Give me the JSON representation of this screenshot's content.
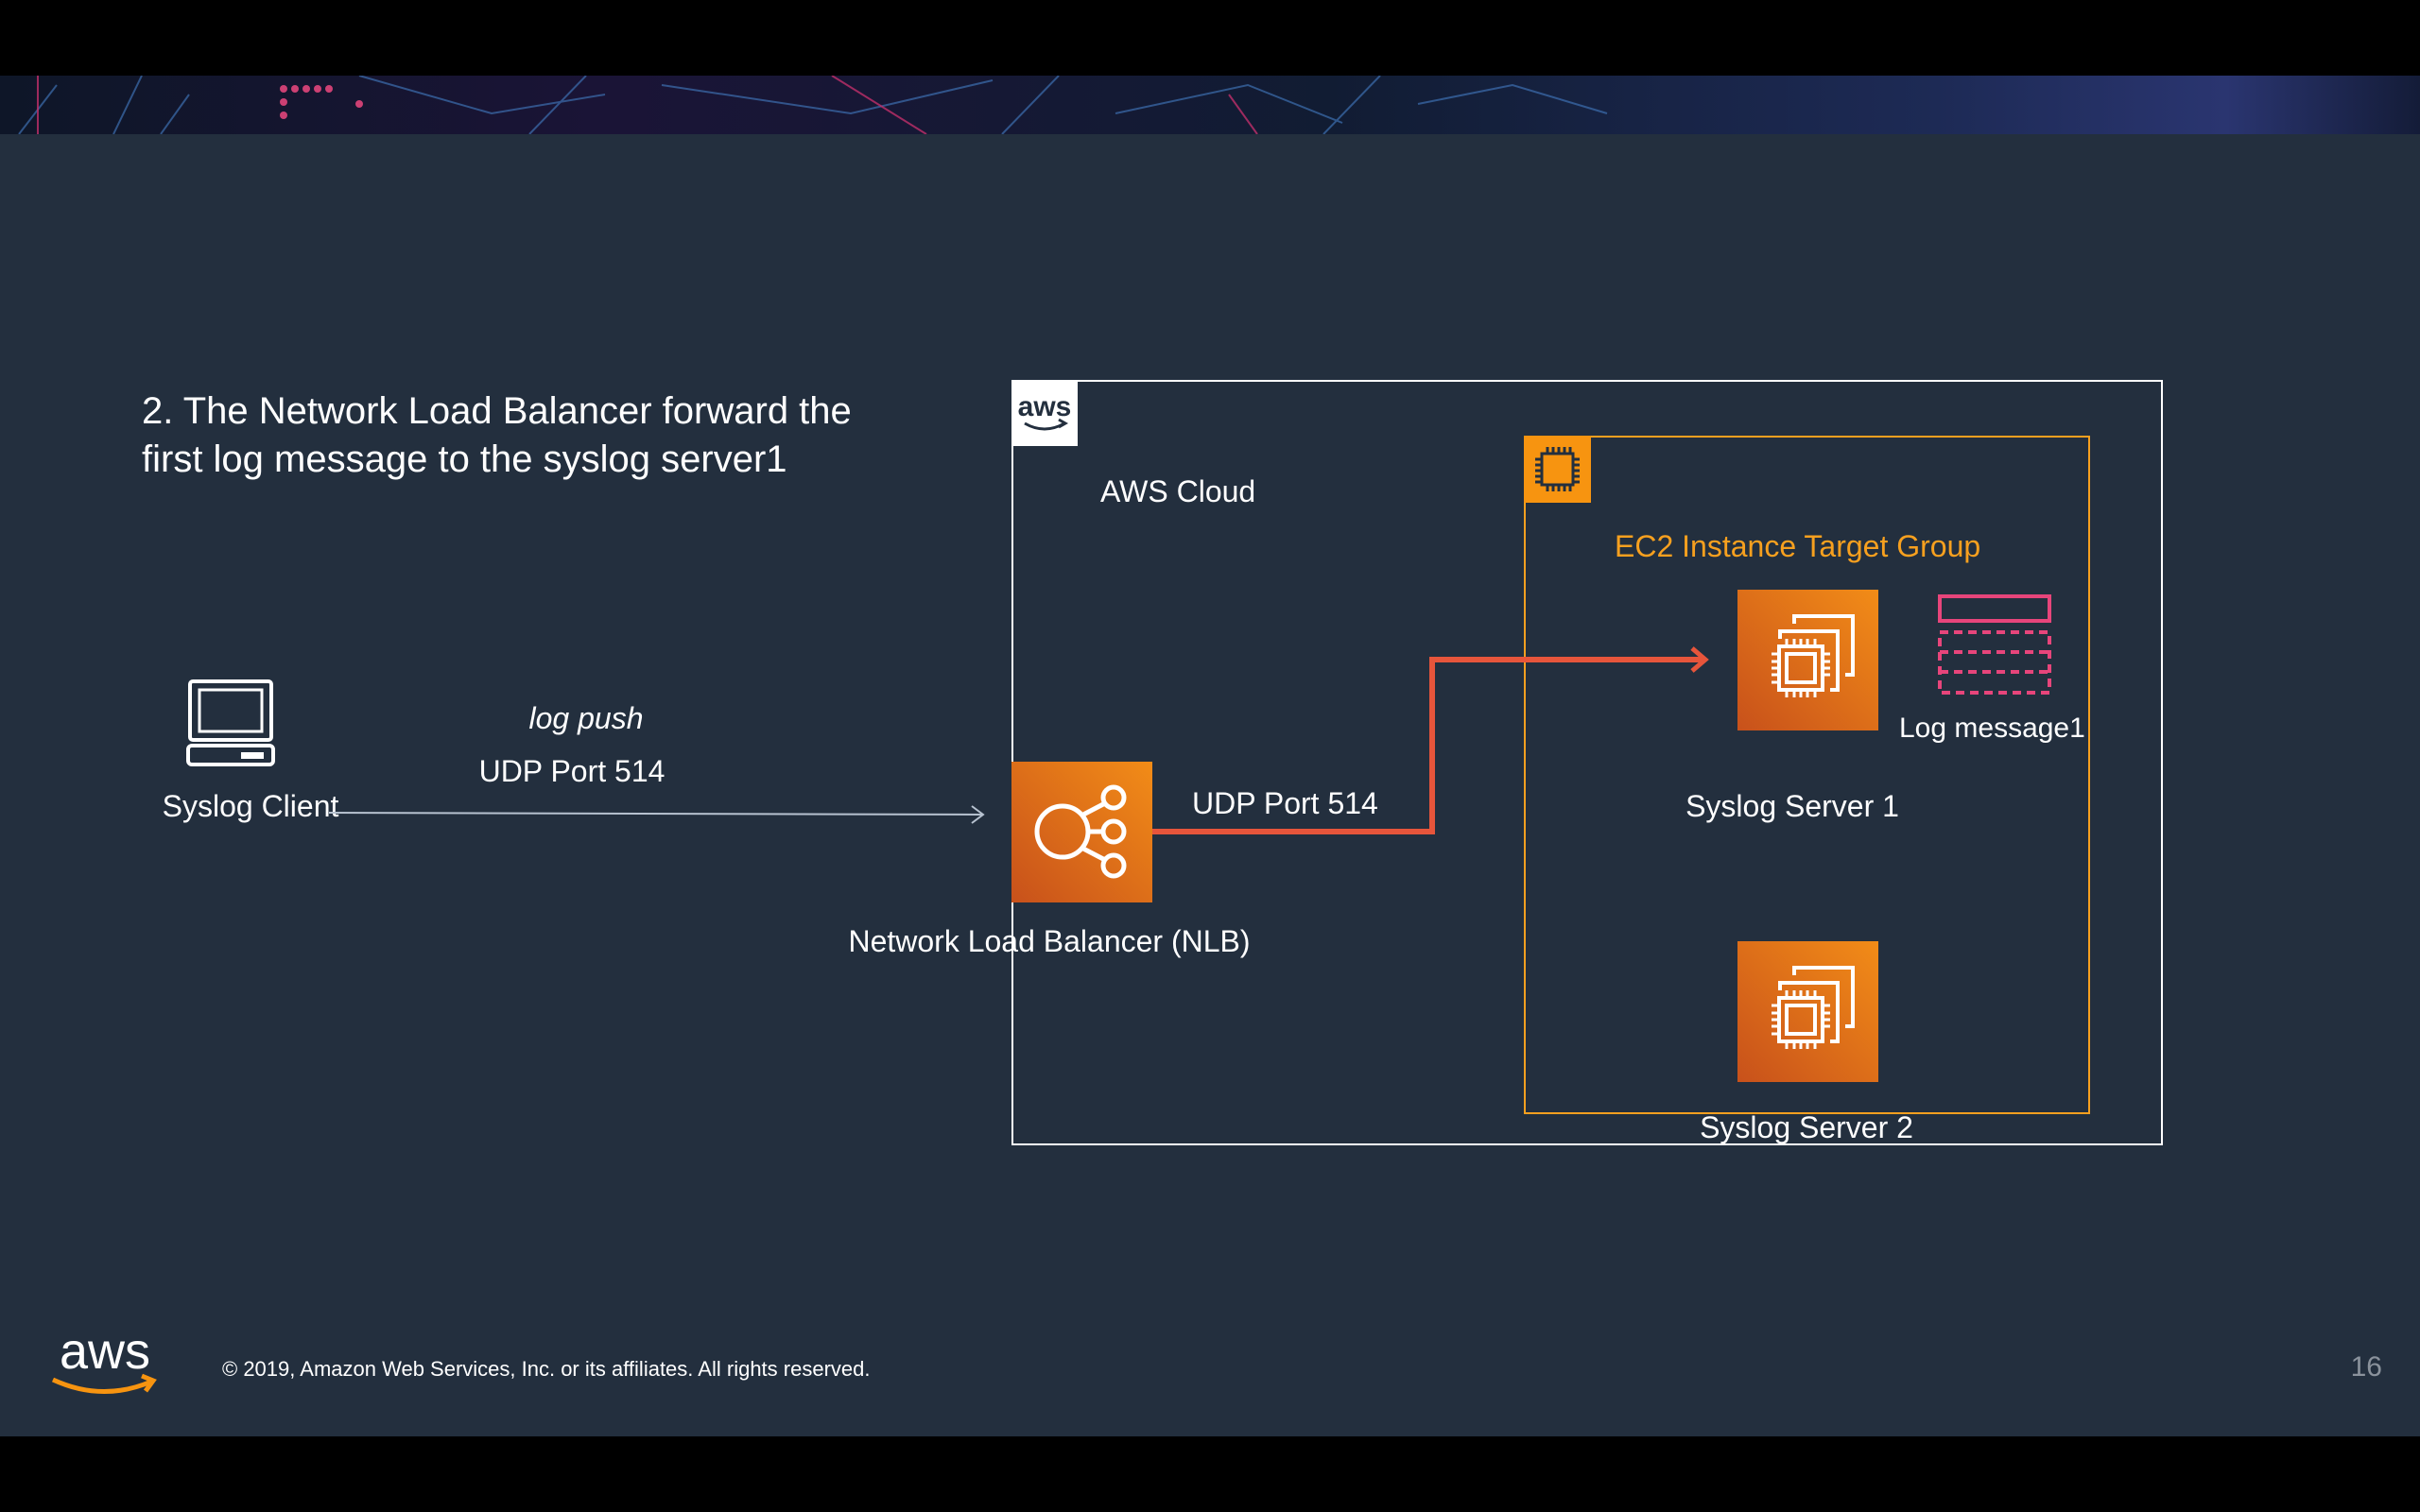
{
  "slide": {
    "title_line1": "2. The Network Load Balancer forward the",
    "title_line2": "first log message to the syslog server1",
    "page_number": "16",
    "footer": "© 2019, Amazon Web Services, Inc. or its affiliates. All rights reserved.",
    "logo_text": "aws"
  },
  "diagram": {
    "client_label": "Syslog Client",
    "push_label": "log push",
    "client_port_label": "UDP Port 514",
    "nlb_label": "Network Load Balancer (NLB)",
    "nlb_port_label": "UDP Port 514",
    "cloud_label": "AWS Cloud",
    "cloud_logo_text": "aws",
    "target_group_label": "EC2 Instance Target Group",
    "server1_label": "Syslog Server 1",
    "server2_label": "Syslog Server 2",
    "log_message_label": "Log message1"
  },
  "colors": {
    "background": "#232f3e",
    "aws_orange": "#f7a01f",
    "route_line": "#e7553b",
    "log_icon": "#e7457b"
  }
}
